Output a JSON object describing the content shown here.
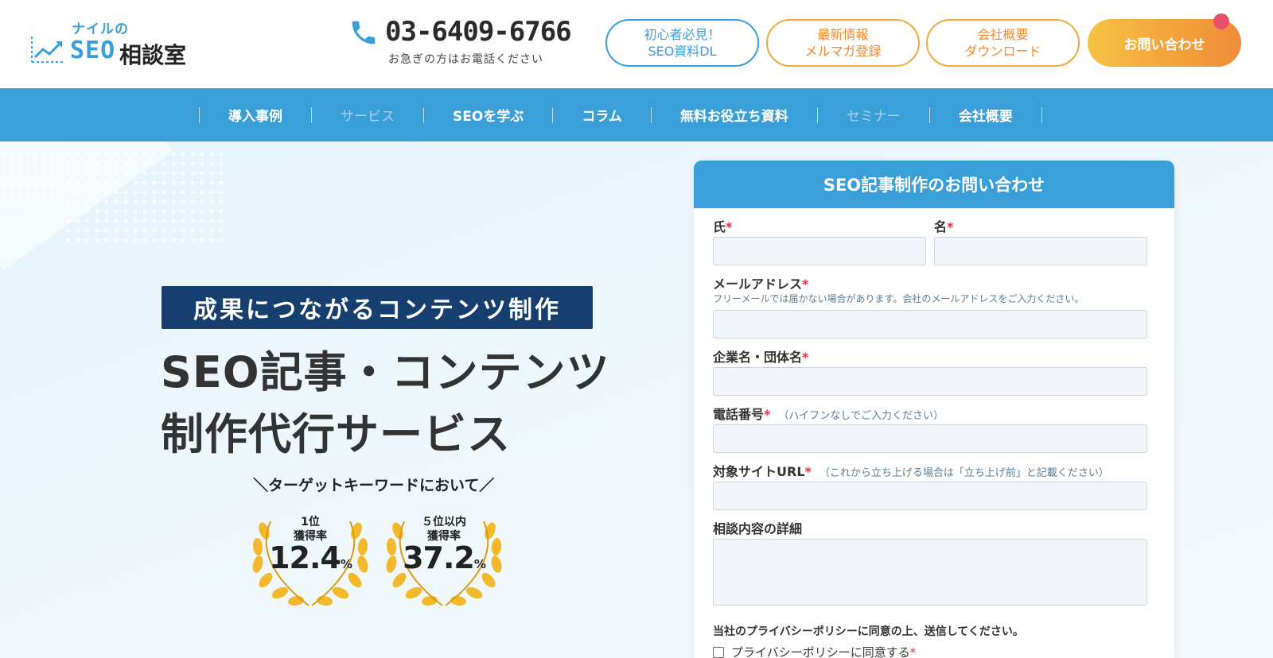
{
  "header": {
    "logo_top": "ナイルの",
    "logo_seo": "SEO",
    "logo_jp": "相談室",
    "phone_number": "03-6409-6766",
    "phone_sub": "お急ぎの方はお電話ください",
    "buttons": [
      {
        "line1": "初心者必見！",
        "line2": "SEO資料DL"
      },
      {
        "line1": "最新情報",
        "line2": "メルマガ登録"
      },
      {
        "line1": "会社概要",
        "line2": "ダウンロード"
      }
    ],
    "cta_label": "お問い合わせ"
  },
  "nav": {
    "items": [
      "導入事例",
      "サービス",
      "SEOを学ぶ",
      "コラム",
      "無料お役立ち資料",
      "セミナー",
      "会社概要"
    ]
  },
  "hero": {
    "tagline": "成果につながるコンテンツ制作",
    "title_line1": "SEO記事・コンテンツ",
    "title_line2": "制作代行サービス",
    "award_head": "＼ターゲットキーワードにおいて／",
    "awards": [
      {
        "line1": "1位",
        "line2": "獲得率",
        "value": "12.4",
        "unit": "%"
      },
      {
        "line1": "５位以内",
        "line2": "獲得率",
        "value": "37.2",
        "unit": "%"
      }
    ]
  },
  "form": {
    "title": "SEO記事制作のお問い合わせ",
    "required_mark": "*",
    "last_name": "氏",
    "first_name": "名",
    "email": "メールアドレス",
    "email_note": "フリーメールでは届かない場合があります。会社のメールアドレスをご入力ください。",
    "company": "企業名・団体名",
    "phone": "電話番号",
    "phone_note": "（ハイフンなしでご入力ください）",
    "site_url": "対象サイトURL",
    "site_url_note": "（これから立ち上げる場合は「立ち上げ前」と記載ください）",
    "details": "相談内容の詳細",
    "consent": "当社のプライバシーポリシーに同意の上、送信してください。",
    "privacy_checkbox": "プライバシーポリシーに同意する"
  },
  "colors": {
    "brand_blue": "#3a9fd9",
    "navy": "#163e6e",
    "orange": "#f08a2e",
    "required_red": "#e5303d"
  }
}
